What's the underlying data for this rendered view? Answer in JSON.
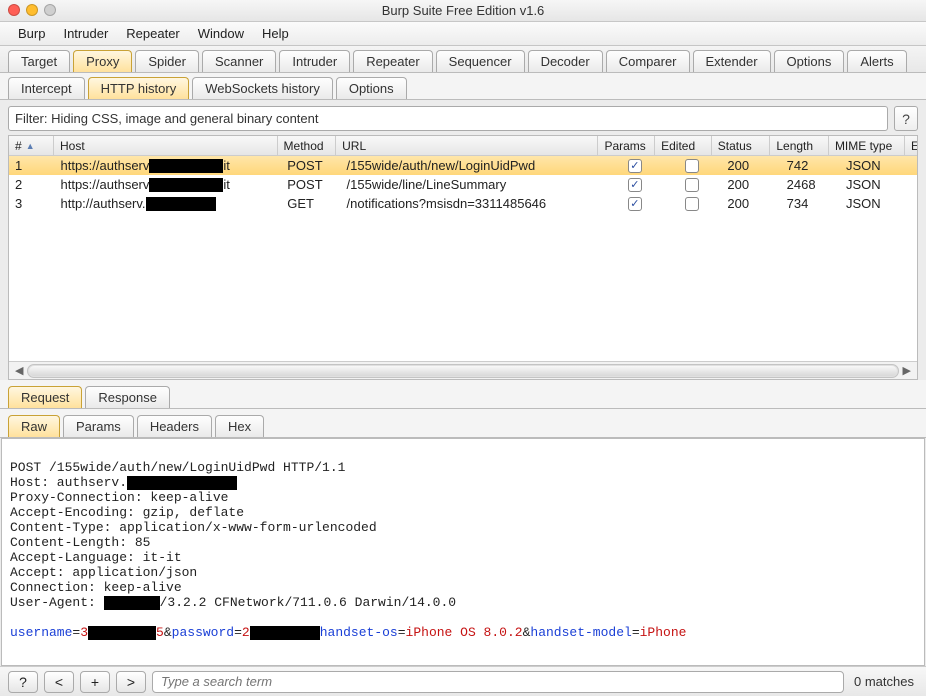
{
  "window": {
    "title": "Burp Suite Free Edition v1.6"
  },
  "menubar": [
    "Burp",
    "Intruder",
    "Repeater",
    "Window",
    "Help"
  ],
  "main_tabs": [
    "Target",
    "Proxy",
    "Spider",
    "Scanner",
    "Intruder",
    "Repeater",
    "Sequencer",
    "Decoder",
    "Comparer",
    "Extender",
    "Options",
    "Alerts"
  ],
  "main_tabs_active": 1,
  "sub_tabs": [
    "Intercept",
    "HTTP history",
    "WebSockets history",
    "Options"
  ],
  "sub_tabs_active": 1,
  "filter_text": "Filter: Hiding CSS, image and general binary content",
  "help_label": "?",
  "columns": {
    "num": "#",
    "host": "Host",
    "method": "Method",
    "url": "URL",
    "params": "Params",
    "edited": "Edited",
    "status": "Status",
    "length": "Length",
    "mime": "MIME type",
    "last": "E"
  },
  "rows": [
    {
      "n": "1",
      "host_pre": "https://authserv",
      "host_suf": "it",
      "method": "POST",
      "url": "/155wide/auth/new/LoginUidPwd",
      "params": true,
      "edited": false,
      "status": "200",
      "length": "742",
      "mime": "JSON",
      "selected": true
    },
    {
      "n": "2",
      "host_pre": "https://authserv",
      "host_suf": "it",
      "method": "POST",
      "url": "/155wide/line/LineSummary",
      "params": true,
      "edited": false,
      "status": "200",
      "length": "2468",
      "mime": "JSON",
      "selected": false
    },
    {
      "n": "3",
      "host_pre": "http://authserv.",
      "host_suf": "",
      "method": "GET",
      "url": "/notifications?msisdn=3311485646",
      "params": true,
      "edited": false,
      "status": "200",
      "length": "734",
      "mime": "JSON",
      "selected": false
    }
  ],
  "panel_tabs": [
    "Request",
    "Response"
  ],
  "panel_tabs_active": 0,
  "view_tabs": [
    "Raw",
    "Params",
    "Headers",
    "Hex"
  ],
  "view_tabs_active": 0,
  "raw": {
    "l1": "POST /155wide/auth/new/LoginUidPwd HTTP/1.1",
    "l2a": "Host: authserv.",
    "l3": "Proxy-Connection: keep-alive",
    "l4": "Accept-Encoding: gzip, deflate",
    "l5": "Content-Type: application/x-www-form-urlencoded",
    "l6": "Content-Length: 85",
    "l7": "Accept-Language: it-it",
    "l8": "Accept: application/json",
    "l9": "Connection: keep-alive",
    "l10a": "User-Agent: ",
    "l10b": "/3.2.2 CFNetwork/711.0.6 Darwin/14.0.0",
    "p_user_k": "username",
    "p_user_v": "3",
    "p_amp1": "&",
    "p_pass_k": "password",
    "p_pass_v": "2",
    "p_os_k": "handset-os",
    "p_os_v": "iPhone OS 8.0.2",
    "p_amp2": "&",
    "p_model_k": "handset-model",
    "p_model_v": "iPhone",
    "p_end": "5",
    "p_eq": "="
  },
  "footer": {
    "btn_q": "?",
    "btn_prev": "<",
    "btn_add": "+",
    "btn_next": ">",
    "search_placeholder": "Type a search term",
    "matches": "0 matches"
  }
}
